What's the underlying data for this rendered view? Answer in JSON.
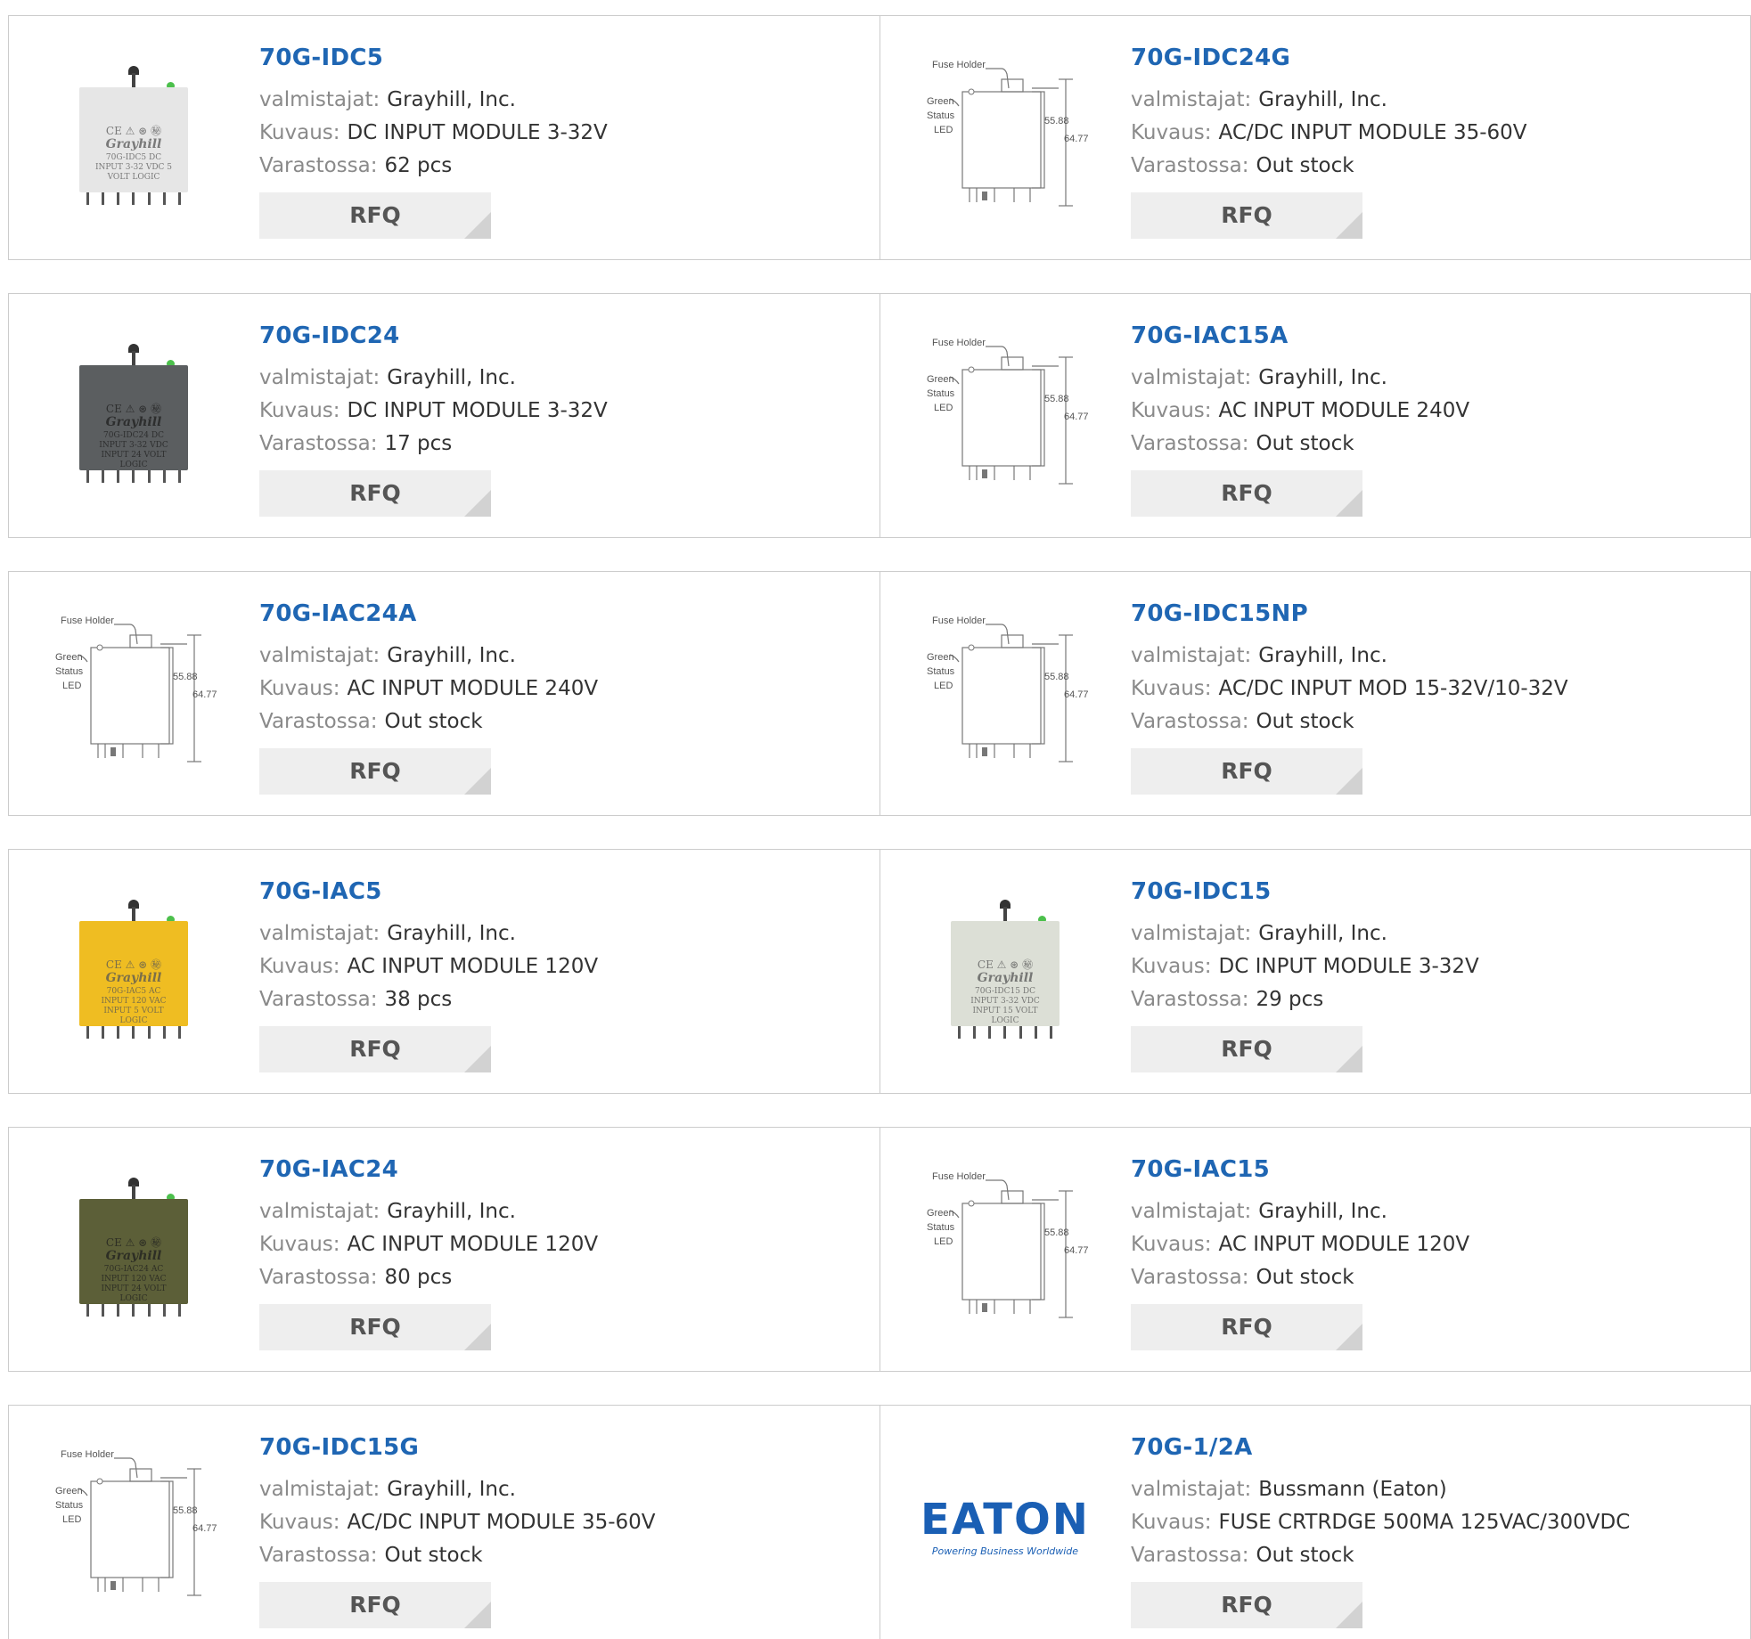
{
  "labels": {
    "manufacturer": "valmistajat:",
    "description": "Kuvaus:",
    "stock": "Varastossa:",
    "rfq": "RFQ"
  },
  "diagram_text": {
    "fuse_holder": "Fuse Holder",
    "green": "Green",
    "status": "Status",
    "led": "LED",
    "dim_inner": "55.88",
    "dim_outer": "64.77"
  },
  "module_logo_text": "Grayhill",
  "eaton_logo": {
    "word": "EATON",
    "tagline": "Powering Business Worldwide"
  },
  "colors": {
    "title_link": "#1f66b3",
    "label_grey": "#8a8a8a",
    "rfq_bg": "#eeeeee",
    "border": "#cccccc"
  },
  "products": [
    {
      "part": "70G-IDC5",
      "manufacturer": "Grayhill, Inc.",
      "description": "DC INPUT MODULE 3-32V",
      "stock": "62 pcs",
      "image": "module-photo",
      "module_color": "#e6e6e6",
      "module_caption": "70G-IDC5 DC INPUT 3-32 VDC 5 VOLT LOGIC"
    },
    {
      "part": "70G-IDC24G",
      "manufacturer": "Grayhill, Inc.",
      "description": "AC/DC INPUT MODULE 35-60V",
      "stock": "Out stock",
      "image": "module-diagram"
    },
    {
      "part": "70G-IDC24",
      "manufacturer": "Grayhill, Inc.",
      "description": "DC INPUT MODULE 3-32V",
      "stock": "17 pcs",
      "image": "module-photo",
      "module_color": "#5b5e60",
      "module_caption": "70G-IDC24 DC INPUT 3-32 VDC INPUT 24 VOLT LOGIC"
    },
    {
      "part": "70G-IAC15A",
      "manufacturer": "Grayhill, Inc.",
      "description": "AC INPUT MODULE 240V",
      "stock": "Out stock",
      "image": "module-diagram"
    },
    {
      "part": "70G-IAC24A",
      "manufacturer": "Grayhill, Inc.",
      "description": "AC INPUT MODULE 240V",
      "stock": "Out stock",
      "image": "module-diagram"
    },
    {
      "part": "70G-IDC15NP",
      "manufacturer": "Grayhill, Inc.",
      "description": "AC/DC INPUT MOD 15-32V/10-32V",
      "stock": "Out stock",
      "image": "module-diagram"
    },
    {
      "part": "70G-IAC5",
      "manufacturer": "Grayhill, Inc.",
      "description": "AC INPUT MODULE 120V",
      "stock": "38 pcs",
      "image": "module-photo",
      "module_color": "#efbd22",
      "module_caption": "70G-IAC5 AC INPUT 120 VAC INPUT 5 VOLT LOGIC"
    },
    {
      "part": "70G-IDC15",
      "manufacturer": "Grayhill, Inc.",
      "description": "DC INPUT MODULE 3-32V",
      "stock": "29 pcs",
      "image": "module-photo",
      "module_color": "#dcdfd6",
      "module_caption": "70G-IDC15 DC INPUT 3-32 VDC INPUT 15 VOLT LOGIC"
    },
    {
      "part": "70G-IAC24",
      "manufacturer": "Grayhill, Inc.",
      "description": "AC INPUT MODULE 120V",
      "stock": "80 pcs",
      "image": "module-photo",
      "module_color": "#5c5f38",
      "module_caption": "70G-IAC24 AC INPUT 120 VAC INPUT 24 VOLT LOGIC"
    },
    {
      "part": "70G-IAC15",
      "manufacturer": "Grayhill, Inc.",
      "description": "AC INPUT MODULE 120V",
      "stock": "Out stock",
      "image": "module-diagram"
    },
    {
      "part": "70G-IDC15G",
      "manufacturer": "Grayhill, Inc.",
      "description": "AC/DC INPUT MODULE 35-60V",
      "stock": "Out stock",
      "image": "module-diagram"
    },
    {
      "part": "70G-1/2A",
      "manufacturer": "Bussmann (Eaton)",
      "description": "FUSE CRTRDGE 500MA 125VAC/300VDC",
      "stock": "Out stock",
      "image": "eaton-logo"
    }
  ]
}
